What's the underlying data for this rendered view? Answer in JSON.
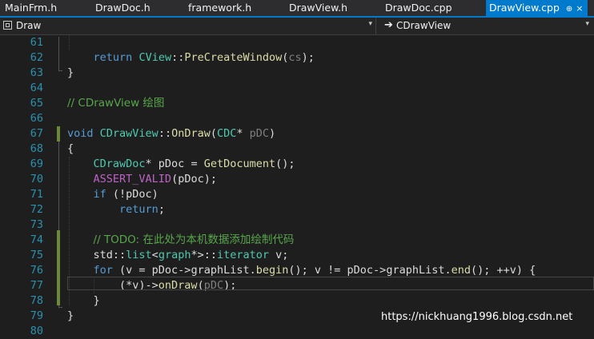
{
  "tabs": [
    {
      "label": "MainFrm.h",
      "active": false
    },
    {
      "label": "DrawDoc.h",
      "active": false
    },
    {
      "label": "framework.h",
      "active": false
    },
    {
      "label": "DrawView.h",
      "active": false
    },
    {
      "label": "DrawDoc.cpp",
      "active": false
    },
    {
      "label": "DrawView.cpp",
      "active": true
    }
  ],
  "active_tab_pin": "⊕",
  "active_tab_close": "×",
  "navbar": {
    "scope_label": "Draw",
    "member_label": "CDrawView",
    "arrow": "➔",
    "dropdown_glyph": "▾"
  },
  "colors": {
    "accent": "#007acc",
    "keyword": "#569cd6",
    "type": "#4ec9b0",
    "function": "#dcdcaa",
    "macro": "#bd63c5",
    "comment": "#57a64a",
    "line_number": "#2b91af"
  },
  "code_lines": [
    {
      "n": "61",
      "tokens": [
        {
          "t": "",
          "c": ""
        }
      ]
    },
    {
      "n": "62",
      "tokens": [
        {
          "t": "    ",
          "c": ""
        },
        {
          "t": "return",
          "c": "kw"
        },
        {
          "t": " ",
          "c": ""
        },
        {
          "t": "CView",
          "c": "ty"
        },
        {
          "t": "::",
          "c": ""
        },
        {
          "t": "PreCreateWindow",
          "c": "fn"
        },
        {
          "t": "(",
          "c": ""
        },
        {
          "t": "cs",
          "c": "pm"
        },
        {
          "t": ");",
          "c": ""
        }
      ]
    },
    {
      "n": "63",
      "tokens": [
        {
          "t": "}",
          "c": ""
        }
      ]
    },
    {
      "n": "64",
      "tokens": [
        {
          "t": "",
          "c": ""
        }
      ]
    },
    {
      "n": "65",
      "tokens": [
        {
          "t": "// CDrawView 绘图",
          "c": "cm"
        }
      ]
    },
    {
      "n": "66",
      "tokens": [
        {
          "t": "",
          "c": ""
        }
      ]
    },
    {
      "n": "67",
      "tokens": [
        {
          "t": "void",
          "c": "kw"
        },
        {
          "t": " ",
          "c": ""
        },
        {
          "t": "CDrawView",
          "c": "ty"
        },
        {
          "t": "::",
          "c": ""
        },
        {
          "t": "OnDraw",
          "c": "fn"
        },
        {
          "t": "(",
          "c": ""
        },
        {
          "t": "CDC",
          "c": "ty"
        },
        {
          "t": "* ",
          "c": ""
        },
        {
          "t": "pDC",
          "c": "pm"
        },
        {
          "t": ")",
          "c": ""
        }
      ]
    },
    {
      "n": "68",
      "tokens": [
        {
          "t": "{",
          "c": ""
        }
      ]
    },
    {
      "n": "69",
      "tokens": [
        {
          "t": "    ",
          "c": ""
        },
        {
          "t": "CDrawDoc",
          "c": "ty"
        },
        {
          "t": "* pDoc = ",
          "c": ""
        },
        {
          "t": "GetDocument",
          "c": "fn"
        },
        {
          "t": "();",
          "c": ""
        }
      ]
    },
    {
      "n": "70",
      "tokens": [
        {
          "t": "    ",
          "c": ""
        },
        {
          "t": "ASSERT_VALID",
          "c": "mac"
        },
        {
          "t": "(pDoc);",
          "c": ""
        }
      ]
    },
    {
      "n": "71",
      "tokens": [
        {
          "t": "    ",
          "c": ""
        },
        {
          "t": "if",
          "c": "kw"
        },
        {
          "t": " (!pDoc)",
          "c": ""
        }
      ]
    },
    {
      "n": "72",
      "tokens": [
        {
          "t": "        ",
          "c": ""
        },
        {
          "t": "return",
          "c": "kw"
        },
        {
          "t": ";",
          "c": ""
        }
      ]
    },
    {
      "n": "73",
      "tokens": [
        {
          "t": "",
          "c": ""
        }
      ]
    },
    {
      "n": "74",
      "tokens": [
        {
          "t": "    ",
          "c": ""
        },
        {
          "t": "// TODO: 在此处为本机数据添加绘制代码",
          "c": "cm"
        }
      ]
    },
    {
      "n": "75",
      "tokens": [
        {
          "t": "    std::",
          "c": ""
        },
        {
          "t": "list",
          "c": "ty"
        },
        {
          "t": "<",
          "c": ""
        },
        {
          "t": "graph",
          "c": "ty"
        },
        {
          "t": "*>::",
          "c": ""
        },
        {
          "t": "iterator",
          "c": "ty"
        },
        {
          "t": " v;",
          "c": ""
        }
      ]
    },
    {
      "n": "76",
      "tokens": [
        {
          "t": "    ",
          "c": ""
        },
        {
          "t": "for",
          "c": "kw"
        },
        {
          "t": " (v = pDoc->",
          "c": ""
        },
        {
          "t": "graphList",
          "c": "mp"
        },
        {
          "t": ".",
          "c": ""
        },
        {
          "t": "begin",
          "c": "fn"
        },
        {
          "t": "(); v != pDoc->",
          "c": ""
        },
        {
          "t": "graphList",
          "c": "mp"
        },
        {
          "t": ".",
          "c": ""
        },
        {
          "t": "end",
          "c": "fn"
        },
        {
          "t": "(); ++v) {",
          "c": ""
        }
      ]
    },
    {
      "n": "77",
      "tokens": [
        {
          "t": "        (*v)->",
          "c": ""
        },
        {
          "t": "onDraw",
          "c": "fn"
        },
        {
          "t": "(",
          "c": ""
        },
        {
          "t": "pDC",
          "c": "pm"
        },
        {
          "t": ");",
          "c": ""
        }
      ]
    },
    {
      "n": "78",
      "tokens": [
        {
          "t": "    }",
          "c": ""
        }
      ]
    },
    {
      "n": "79",
      "tokens": [
        {
          "t": "}",
          "c": ""
        }
      ]
    },
    {
      "n": "80",
      "tokens": [
        {
          "t": "",
          "c": ""
        }
      ]
    }
  ],
  "watermark": "https://nickhuang1996.blog.csdn.net"
}
